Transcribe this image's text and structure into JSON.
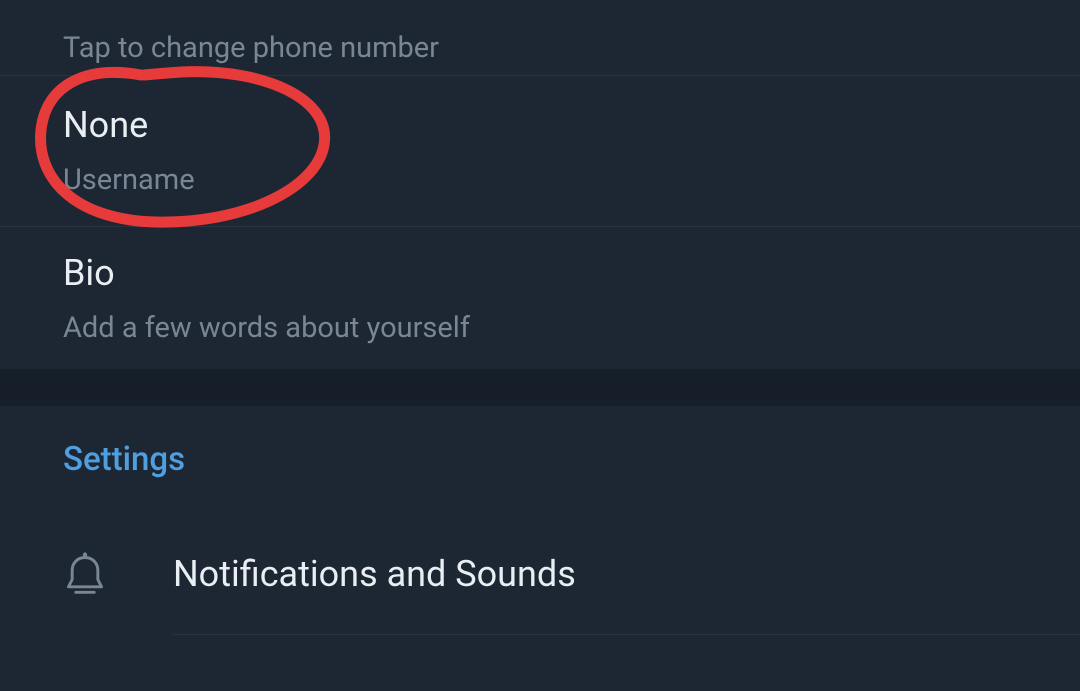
{
  "profile": {
    "phone_hint": "Tap to change phone number",
    "username_value": "None",
    "username_label": "Username",
    "bio_label": "Bio",
    "bio_hint": "Add a few words about yourself"
  },
  "settings": {
    "header": "Settings",
    "items": [
      {
        "label": "Notifications and Sounds",
        "icon": "bell-icon"
      }
    ]
  },
  "annotation": {
    "circle_color": "#e73b3b"
  }
}
